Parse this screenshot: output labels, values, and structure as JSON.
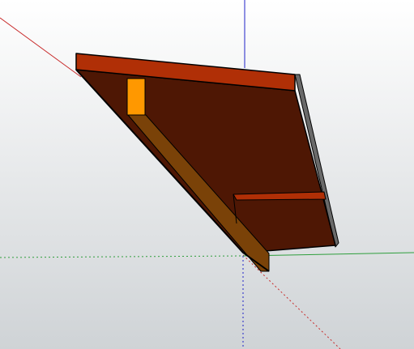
{
  "viewport": {
    "background_top": "#ffffff",
    "background_bottom": "#cfd3d6"
  },
  "axes": {
    "red": "#c82a2a",
    "green": "#2e9e3c",
    "blue": "#1f22c8"
  },
  "model": {
    "top_face_color": "#4e1704",
    "front_edge_color": "#b02f06",
    "side_edge_color": "#6a6a6a",
    "beam_color": "#7a4208",
    "beam_end_color": "#ff9800",
    "bracket_color": "#b02f06",
    "outline_color": "#000000"
  }
}
